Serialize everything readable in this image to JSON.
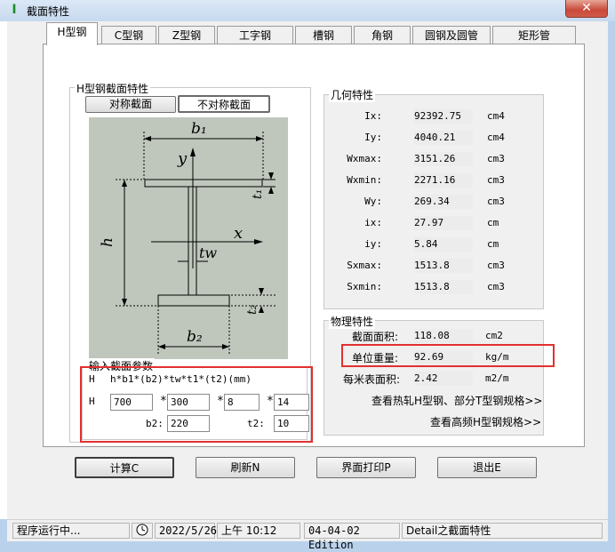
{
  "window": {
    "title": "截面特性",
    "close": "✕"
  },
  "tabs": [
    "H型钢",
    "C型钢",
    "Z型钢",
    "工字钢",
    "槽钢",
    "角钢",
    "圆钢及圆管",
    "矩形管"
  ],
  "h_section": {
    "group_title": "H型钢截面特性",
    "symmetric_btn": "对称截面",
    "asymmetric_btn": "不对称截面",
    "diagram": {
      "b1": "b₁",
      "b2": "b₂",
      "y": "y",
      "x": "x",
      "h": "h",
      "tw": "tw",
      "t1": "t₁",
      "t2": "t₂"
    }
  },
  "input": {
    "group_title": "输入截面参数",
    "formula_label": "H",
    "formula": "h*b1*(b2)*tw*t1*(t2)(mm)",
    "row_label": "H",
    "h": "700",
    "b1": "300",
    "tw": "8",
    "t1": "14",
    "b2_label": "b2:",
    "b2": "220",
    "t2_label": "t2:",
    "t2": "10",
    "star": "*"
  },
  "geometry": {
    "group_title": "几何特性",
    "rows": [
      {
        "label": "Ix:",
        "value": "92392.75",
        "unit": "cm4"
      },
      {
        "label": "Iy:",
        "value": "4040.21",
        "unit": "cm4"
      },
      {
        "label": "Wxmax:",
        "value": "3151.26",
        "unit": "cm3"
      },
      {
        "label": "Wxmin:",
        "value": "2271.16",
        "unit": "cm3"
      },
      {
        "label": "Wy:",
        "value": "269.34",
        "unit": "cm3"
      },
      {
        "label": "ix:",
        "value": "27.97",
        "unit": "cm"
      },
      {
        "label": "iy:",
        "value": "5.84",
        "unit": "cm"
      },
      {
        "label": "Sxmax:",
        "value": "1513.8",
        "unit": "cm3"
      },
      {
        "label": "Sxmin:",
        "value": "1513.8",
        "unit": "cm3"
      }
    ]
  },
  "physical": {
    "group_title": "物理特性",
    "area_label": "截面面积:",
    "area_value": "118.08",
    "area_unit": "cm2",
    "weight_label": "单位重量:",
    "weight_value": "92.69",
    "weight_unit": "kg/m",
    "surface_label": "每米表面积:",
    "surface_value": "2.42",
    "surface_unit": "m2/m",
    "link_hot": "查看热轧H型钢、部分T型钢规格>>",
    "link_hf": "查看高频H型钢规格>>"
  },
  "buttons": {
    "calc": "计算C",
    "refresh": "刷新N",
    "print": "界面打印P",
    "exit": "退出E"
  },
  "status": {
    "running": "程序运行中...",
    "date": "2022/5/26",
    "time": "上午 10:12",
    "edition": "04-04-02 Edition",
    "module": "Detail之截面特性"
  }
}
